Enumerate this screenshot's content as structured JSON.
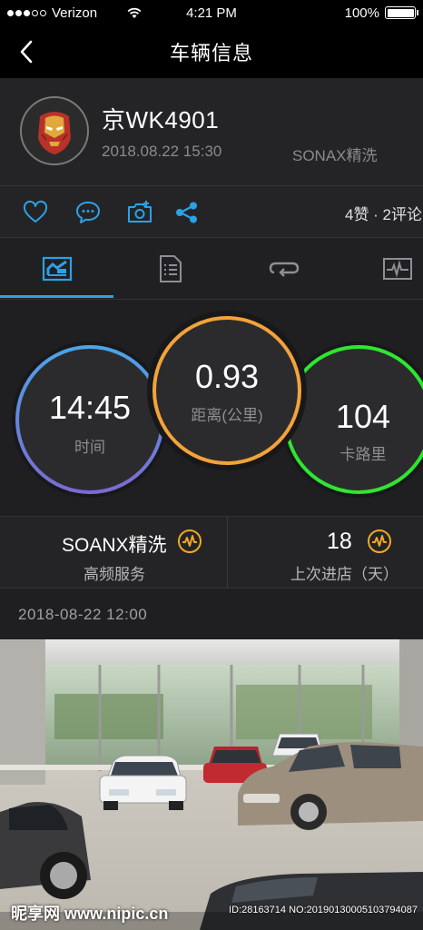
{
  "status_bar": {
    "carrier": "Verizon",
    "time": "4:21 PM",
    "battery": "100%",
    "battery_level": 1.0
  },
  "nav": {
    "title": "车辆信息"
  },
  "profile": {
    "plate": "京WK4901",
    "datetime": "2018.08.22 15:30",
    "service": "SONAX精洗"
  },
  "actions": {
    "stats": "4赞 · 2评论"
  },
  "tabs": [
    "overview",
    "document",
    "repeat",
    "pulse-monitor"
  ],
  "gauges": [
    {
      "value": "14:45",
      "label": "时间",
      "color_start": "#4ba4e8",
      "color_end": "#7b6bd1"
    },
    {
      "value": "0.93",
      "label": "距离(公里)",
      "color": "#f3a23b"
    },
    {
      "value": "104",
      "label": "卡路里",
      "color": "#2ee631"
    }
  ],
  "info": {
    "left_main": "SOANX精洗",
    "left_sub": "高频服务",
    "right_main": "18",
    "right_sub": "上次进店（天）",
    "accent": "#f0a828"
  },
  "post": {
    "timestamp": "2018-08-22   12:00"
  },
  "watermark": {
    "logo": "昵享网 www.nipic.cn",
    "id": "ID:28163714 NO:20190130005103794087"
  }
}
